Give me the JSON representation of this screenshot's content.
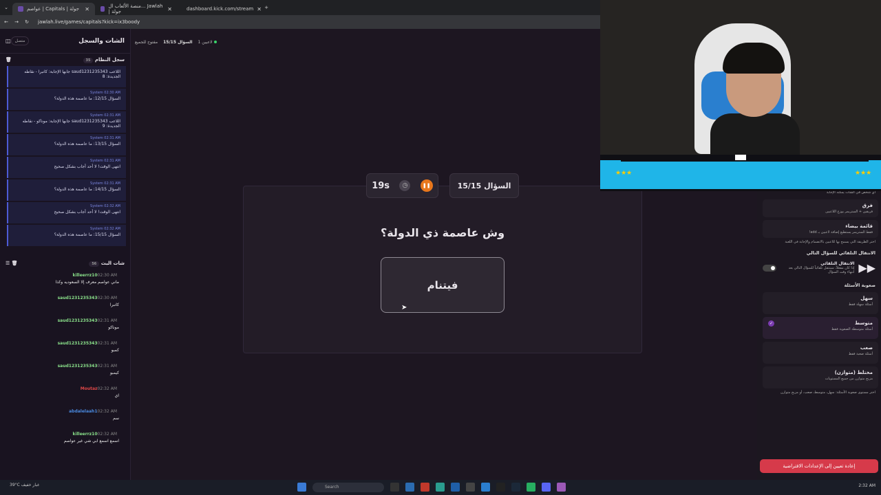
{
  "browser": {
    "tabs": [
      {
        "title": "عواصم | Capitals | جولة",
        "active": true
      },
      {
        "title": "منصة الألعاب ال... Jawlah | جولة",
        "active": false
      },
      {
        "title": "dashboard.kick.com/stream",
        "active": false
      }
    ],
    "url": "jawlah.live/games/capitals?kick=ix3boody"
  },
  "chat_panel": {
    "title": "الشات والسجل",
    "connected": "متصل",
    "system_log": {
      "title": "سجل النظام",
      "count": "35",
      "items": [
        {
          "meta": "",
          "msg": "اللاعب saud1231235343 جابها الإجابة: كانبرا - نقاطه الجديدة: 8"
        },
        {
          "meta": "System 02:30 AM",
          "msg": "السؤال 12/15: ما عاصمة هذه الدولة؟"
        },
        {
          "meta": "System 02:31 AM",
          "msg": "اللاعب saud1231235343 جابها الإجابة: موناكو - نقاطه الجديدة: 9"
        },
        {
          "meta": "System 02:31 AM",
          "msg": "السؤال 13/15: ما عاصمة هذه الدولة؟"
        },
        {
          "meta": "System 02:31 AM",
          "msg": "انتهى الوقت! لا أحد أجاب بشكل صحيح"
        },
        {
          "meta": "System 02:31 AM",
          "msg": "السؤال 14/15: ما عاصمة هذه الدولة؟"
        },
        {
          "meta": "System 02:32 AM",
          "msg": "انتهى الوقت! لا أحد أجاب بشكل صحيح"
        },
        {
          "meta": "System 02:32 AM",
          "msg": "السؤال 15/15: ما عاصمة هذه الدولة؟"
        }
      ]
    },
    "live_chat": {
      "title": "شات البث",
      "count": "56",
      "items": [
        {
          "user": "killeerrz10",
          "time": "02:30 AM",
          "msg": "ماني عواصم معرف إلا السعوديه وكذا",
          "color": "#8ae08a"
        },
        {
          "user": "saud1231235343",
          "time": "02:30 AM",
          "msg": "كانبرا",
          "color": "#8ae08a"
        },
        {
          "user": "saud1231235343",
          "time": "02:31 AM",
          "msg": "موناكو",
          "color": "#8ae08a"
        },
        {
          "user": "saud1231235343",
          "time": "02:31 AM",
          "msg": "كمبو",
          "color": "#8ae08a"
        },
        {
          "user": "saud1231235343",
          "time": "02:31 AM",
          "msg": "كيمبو",
          "color": "#8ae08a"
        },
        {
          "user": "Moutaz",
          "time": "02:32 AM",
          "msg": "اي",
          "color": "#e04848"
        },
        {
          "user": "abdalelaah1",
          "time": "02:32 AM",
          "msg": "سم",
          "color": "#4a8ae0"
        },
        {
          "user": "killeerrz10",
          "time": "02:32 AM",
          "msg": "اسمع اسمع ابي شي غير عواصم",
          "color": "#8ae08a"
        }
      ]
    }
  },
  "status": {
    "players": "1 لاعبين",
    "question": "السؤال 15/15",
    "mode": "مفتوح للجميع"
  },
  "game": {
    "question_counter": "السؤال 15/15",
    "timer": "19s",
    "question": "وش عاصمة ذي الدولة؟",
    "answer": "فيتنام"
  },
  "settings": {
    "top_note": "أي شخص في الشات يمكنه الإجابة",
    "teams": {
      "title": "فرق",
      "desc": "فريقين + الستريمر يوزع اللاعبين"
    },
    "whitelist": {
      "title": "قائمة بيضاء",
      "desc": "فقط الستريمر يستطيع إضافة لاعبين بـ add!"
    },
    "mode_note": "اختر الطريقة التي يسمح بها للاعبين بالانضمام والإجابة في اللعبة",
    "auto_next_head": "الانتقال التلقائي للسؤال التالي",
    "auto_next": {
      "title": "الانتقال التلقائي",
      "desc": "إذا كان مفعلاً، سينتقل تلقائياً للسؤال التالي بعد انتهاء وقت السؤال"
    },
    "difficulty_head": "صعوبة الأسئلة",
    "difficulties": [
      {
        "title": "سهل",
        "desc": "أسئلة سهلة فقط",
        "selected": false
      },
      {
        "title": "متوسط",
        "desc": "أسئلة متوسطة الصعوبة فقط",
        "selected": true
      },
      {
        "title": "صعب",
        "desc": "أسئلة صعبة فقط",
        "selected": false
      },
      {
        "title": "مختلط (متوازن)",
        "desc": "مزيج متوازن من جميع المستويات",
        "selected": false
      }
    ],
    "difficulty_note": "اختر مستوى صعوبة الأسئلة: سهل، متوسط، صعب، أو مزيج متوازن",
    "reset": "إعادة تعيين إلى الإعدادات الافتراضية"
  },
  "taskbar": {
    "weather": "39°C",
    "weather_desc": "غبار خفيف",
    "search": "Search",
    "time": "2:32 AM"
  },
  "colors": {
    "accent": "#e8771c",
    "system_border": "#4d5bd6",
    "reset": "#d63a4a",
    "overlay_blue": "#1fb5e8"
  }
}
